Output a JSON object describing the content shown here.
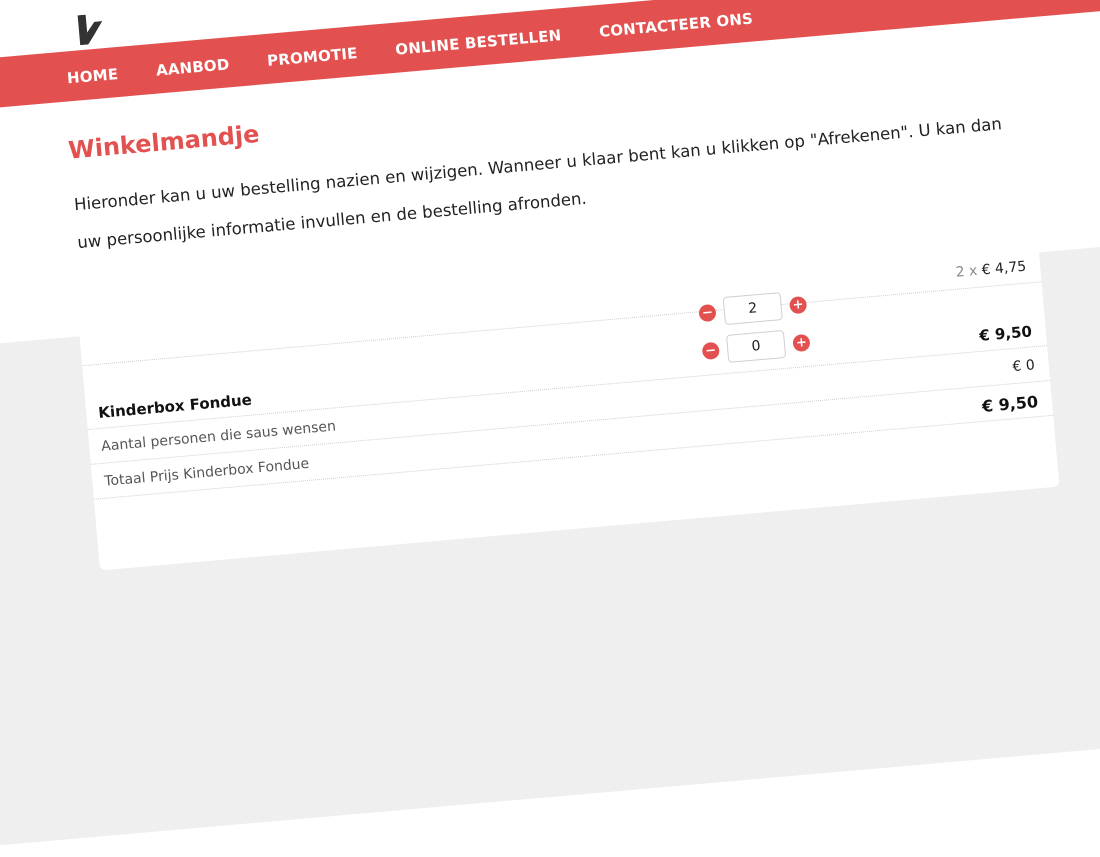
{
  "nav": {
    "items": [
      "HOME",
      "AANBOD",
      "PROMOTIE",
      "ONLINE BESTELLEN",
      "CONTACTEER ONS"
    ]
  },
  "page": {
    "title": "Winkelmandje",
    "intro": "Hieronder kan u uw bestelling nazien en wijzigen. Wanneer u klaar bent kan u klikken op \"Afrekenen\". U kan dan uw persoonlijke informatie invullen en de bestelling afronden."
  },
  "cart": {
    "quantities": [
      "2",
      "0"
    ],
    "unit_qty": "2 x",
    "unit_price": "€ 4,75",
    "product_name": "Kinderbox Fondue",
    "product_price": "€ 9,50",
    "sauce_label": "Aantal personen die saus wensen",
    "sauce_price": "€ 0",
    "total_label": "Totaal Prijs Kinderbox Fondue",
    "total_price": "€ 9,50",
    "minus_symbol": "−",
    "plus_symbol": "+"
  },
  "colors": {
    "accent": "#e2514f",
    "band": "#efefef"
  }
}
